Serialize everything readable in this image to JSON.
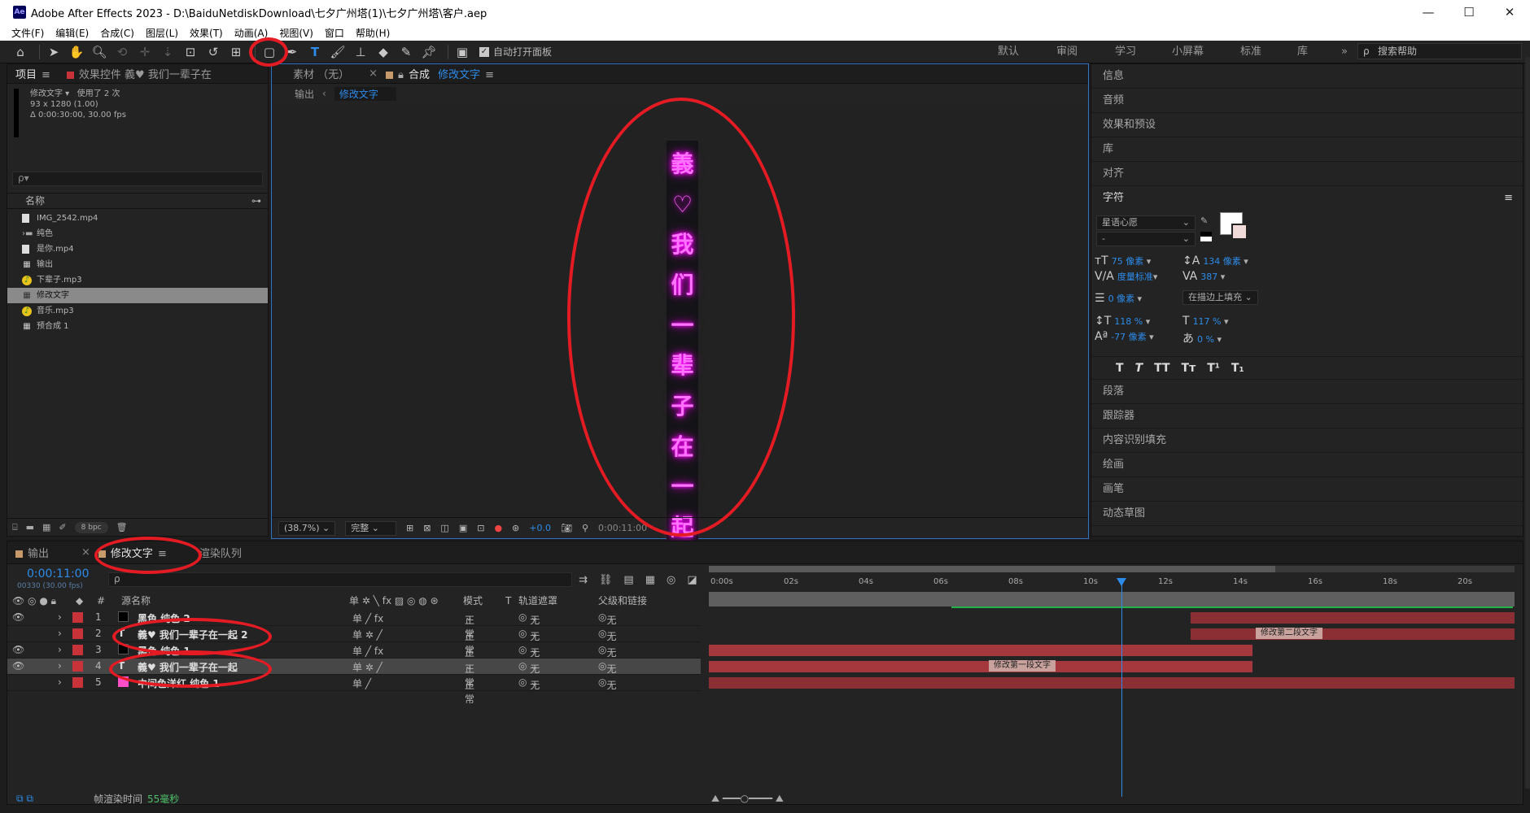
{
  "titlebar": {
    "app_icon": "Ae",
    "title": "Adobe After Effects 2023 - D:\\BaiduNetdiskDownload\\七夕广州塔(1)\\七夕广州塔\\客户.aep",
    "min": "—",
    "max": "☐",
    "close": "✕"
  },
  "menu": [
    "文件(F)",
    "编辑(E)",
    "合成(C)",
    "图层(L)",
    "效果(T)",
    "动画(A)",
    "视图(V)",
    "窗口",
    "帮助(H)"
  ],
  "toolbar": {
    "auto_open": "自动打开面板",
    "workspaces": [
      "默认",
      "审阅",
      "学习",
      "小屏幕",
      "标准",
      "库"
    ],
    "more": "»",
    "search_help": "搜索帮助"
  },
  "project": {
    "tab_project": "项目",
    "tab_effects": "效果控件 義♥ 我们一辈子在",
    "info_name": "修改文字",
    "info_used": "使用了 2 次",
    "info_dims": "93 x 1280 (1.00)",
    "info_duration": "Δ 0:00:30:00, 30.00 fps",
    "search_icon": "ρ▾",
    "col_name": "名称",
    "items": [
      {
        "icon": "file",
        "name": "IMG_2542.mp4"
      },
      {
        "icon": "folder",
        "name": "纯色"
      },
      {
        "icon": "file",
        "name": "是你.mp4"
      },
      {
        "icon": "comp",
        "name": "输出"
      },
      {
        "icon": "audio",
        "name": "下辈子.mp3"
      },
      {
        "icon": "comp",
        "name": "修改文字"
      },
      {
        "icon": "audio",
        "name": "音乐.mp3"
      },
      {
        "icon": "comp",
        "name": "预合成 1"
      }
    ],
    "bpc": "8 bpc"
  },
  "composition": {
    "tab_footage": "素材 （无）",
    "tab_comp_prefix": "合成",
    "tab_comp_name": "修改文字",
    "sub_output": "输出",
    "sub_active": "修改文字",
    "canvas_chars": [
      "義",
      "♡",
      "我",
      "们",
      "一",
      "辈",
      "子",
      "在",
      "一",
      "起"
    ],
    "zoom": "(38.7%)",
    "quality": "完整",
    "exposure": "+0.0",
    "timecode": "0:00:11:00"
  },
  "right": {
    "sections_top": [
      "信息",
      "音频",
      "效果和预设",
      "库",
      "对齐"
    ],
    "character": {
      "title": "字符",
      "font": "星语心愿",
      "style": "-",
      "size": "75 像素",
      "leading": "134 像素",
      "kerning": "度量标准",
      "tracking": "387",
      "stroke": "0 像素",
      "stroke_mode": "在描边上填充",
      "vscale": "118 %",
      "hscale": "117 %",
      "baseline": "-77 像素",
      "tsume": "0 %",
      "styles": [
        "T",
        "T",
        "TT",
        "Tт",
        "T¹",
        "T₁"
      ]
    },
    "sections_bottom": [
      "段落",
      "跟踪器",
      "内容识别填充",
      "绘画",
      "画笔",
      "动态草图"
    ]
  },
  "timeline": {
    "tab_output": "输出",
    "tab_comp": "修改文字",
    "tab_render": "渲染队列",
    "timecode": "0:00:11:00",
    "frames": "00330 (30.00 fps)",
    "col_source": "源名称",
    "col_mode": "模式",
    "col_t": "T",
    "col_track": "轨道遮罩",
    "col_parent": "父级和链接",
    "col_num": "#",
    "ruler": [
      "0:00s",
      "02s",
      "04s",
      "06s",
      "08s",
      "10s",
      "12s",
      "14s",
      "16s",
      "18s",
      "20s"
    ],
    "layers": [
      {
        "num": "1",
        "color": "#c8333a",
        "name": "黑色 纯色 2",
        "mode": "正常",
        "track": "无",
        "parent": "无",
        "fx": true
      },
      {
        "num": "2",
        "color": "#c8333a",
        "name": "義♥ 我们一辈子在一起 2",
        "mode": "正常",
        "track": "无",
        "parent": "无",
        "fx": false
      },
      {
        "num": "3",
        "color": "#c8333a",
        "name": "黑色 纯色 1",
        "mode": "正常",
        "track": "无",
        "parent": "无",
        "fx": true
      },
      {
        "num": "4",
        "color": "#c8333a",
        "name": "義♥ 我们一辈子在一起",
        "mode": "正常",
        "track": "无",
        "parent": "无",
        "fx": false
      },
      {
        "num": "5",
        "color": "#c8333a",
        "name": "中间色洋红 纯色 1",
        "mode": "正常",
        "track": "无",
        "parent": "无",
        "fx": false
      }
    ],
    "markers": [
      "修改第二段文字",
      "修改第一段文字"
    ],
    "render_label": "帧渲染时间",
    "render_value": "55毫秒"
  },
  "colors": {
    "accent": "#2d8ceb",
    "annotation_red": "#e51b24",
    "neon": "#ff73ff"
  }
}
